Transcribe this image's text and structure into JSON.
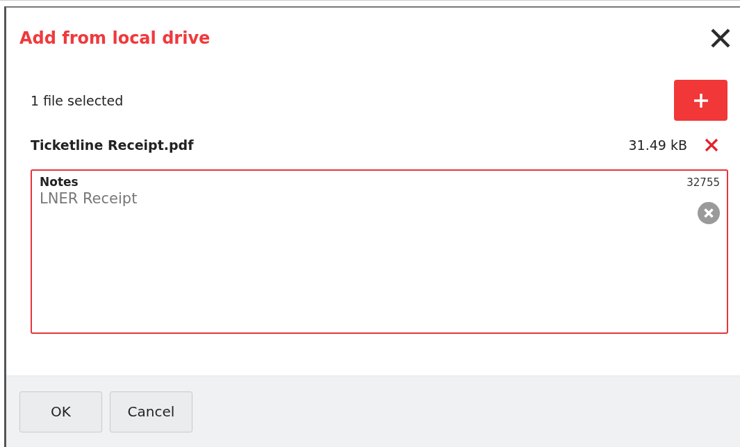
{
  "dialog": {
    "title": "Add from local drive"
  },
  "selection": {
    "summary": "1 file selected"
  },
  "files": [
    {
      "name": "Ticketline Receipt.pdf",
      "size": "31.49 kB"
    }
  ],
  "notes": {
    "label": "Notes",
    "counter": "32755",
    "value": "LNER Receipt"
  },
  "buttons": [
    "OK",
    "Cancel"
  ]
}
